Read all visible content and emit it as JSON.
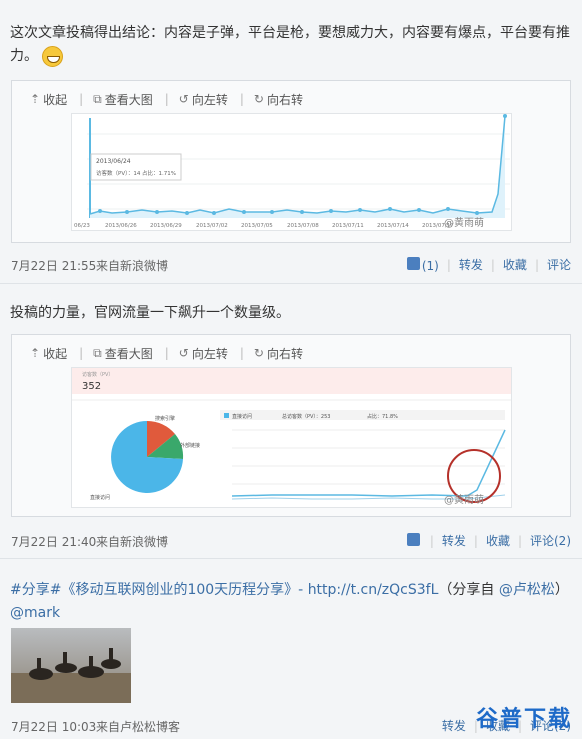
{
  "posts": [
    {
      "text": "这次文章投稿得出结论：内容是子弹，平台是枪，要想威力大，内容要有爆点，平台要有推力。",
      "toolbar": {
        "collapse": "收起",
        "view_large": "查看大图",
        "rotate_left": "向左转",
        "rotate_right": "向右转"
      },
      "chart": {
        "tooltip_date": "2013/06/24",
        "tooltip_visits": "访客数（PV）：14",
        "tooltip_pages": "占比：1.71%",
        "x_labels": [
          "06/23",
          "2013/06/26",
          "2013/06/29",
          "2013/07/02",
          "2013/07/05",
          "2013/07/08",
          "2013/07/11",
          "2013/07/14",
          "2013/07/17"
        ],
        "watermark": "@黄雨萌"
      },
      "time": "7月22日 21:55",
      "source": "来自新浪微博",
      "like_count": "(1)",
      "forward": "转发",
      "favorite": "收藏",
      "comment": "评论"
    },
    {
      "text": "投稿的力量，官网流量一下飙升一个数量级。",
      "toolbar": {
        "collapse": "收起",
        "view_large": "查看大图",
        "rotate_left": "向左转",
        "rotate_right": "向右转"
      },
      "stats": {
        "label": "访客数（PV）",
        "value": "352",
        "pie_labels": [
          "搜索引擎",
          "外部链接",
          "直接访问"
        ],
        "legend_label": "直接访问",
        "total_label": "总访客数（PV）：253",
        "share_label": "占比：71.8%",
        "watermark": "@黄雨萌"
      },
      "time": "7月22日 21:40",
      "source": "来自新浪微博",
      "forward": "转发",
      "favorite": "收藏",
      "comment": "评论(2)"
    },
    {
      "text_prefix": "#分享#《移动互联网创业的100天历程分享》- ",
      "link": "http://t.cn/zQcS3fL",
      "text_mid": "（分享自 ",
      "mention1": "@卢松松",
      "text_suffix": "）",
      "mention2": "@mark",
      "time": "7月22日 10:03",
      "source": "来自卢松松博客",
      "forward": "转发",
      "favorite": "收藏",
      "comment": "评论(2)"
    }
  ],
  "watermark": "谷普下载",
  "colors": {
    "link": "#3b6ea5",
    "chart_line": "#5bb9e2",
    "pie_blue": "#4bb6e8",
    "pie_red": "#e05a3c",
    "pie_green": "#3aa86b"
  }
}
